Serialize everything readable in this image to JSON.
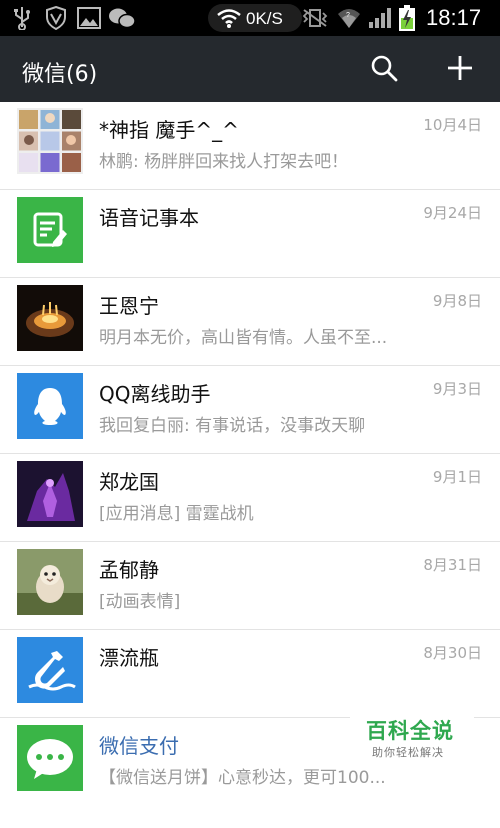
{
  "status_bar": {
    "icons": [
      "usb-icon",
      "shield-icon",
      "image-icon",
      "wechat-icon",
      "wifi-icon",
      "vibrate-icon",
      "wifi-signal-icon",
      "cell-signal-icon",
      "battery-charging-icon"
    ],
    "net_speed": "0K/S",
    "time": "18:17"
  },
  "app_bar": {
    "title": "微信(6)",
    "icons": [
      "search-icon",
      "plus-icon"
    ]
  },
  "chats": [
    {
      "name": "*神指 魔手^_^",
      "time": "10月4日",
      "preview": "林鹏: 杨胖胖回来找人打架去吧！"
    },
    {
      "name": "语音记事本",
      "time": "9月24日",
      "preview": ""
    },
    {
      "name": "王恩宁",
      "time": "9月8日",
      "preview": "明月本无价，高山皆有情。人虽不至..."
    },
    {
      "name": "QQ离线助手",
      "time": "9月3日",
      "preview": "我回复白丽: 有事说话，没事改天聊"
    },
    {
      "name": "郑龙国",
      "time": "9月1日",
      "preview": "[应用消息] 雷霆战机"
    },
    {
      "name": "孟郁静",
      "time": "8月31日",
      "preview": "[动画表情]"
    },
    {
      "name": "漂流瓶",
      "time": "8月30日",
      "preview": ""
    },
    {
      "name": "微信支付",
      "time": "",
      "preview": "【微信送月饼】心意秒达，更可100..."
    }
  ],
  "watermark": {
    "title": "百科全说",
    "subtitle": "助你轻松解决"
  },
  "colors": {
    "status_bar": "#000000",
    "app_bar": "#25292e",
    "green_tile": "#3ab547",
    "blue_tile": "#2d8ae0",
    "watermark_green": "#2fa84f"
  }
}
